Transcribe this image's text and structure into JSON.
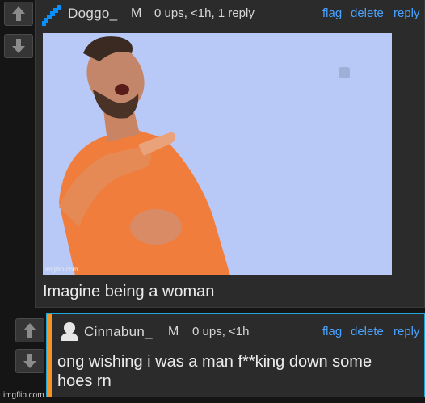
{
  "comment1": {
    "username": "Doggo_",
    "mod_badge": "M",
    "meta": "0 ups, <1h, 1 reply",
    "actions": {
      "flag": "flag",
      "delete": "delete",
      "reply": "reply"
    },
    "image_watermark": "imgflip.com",
    "text": "Imagine being a woman",
    "accent_color": "#0a8ffc"
  },
  "comment2": {
    "username": "Cinnabun_",
    "mod_badge": "M",
    "meta": "0 ups, <1h",
    "actions": {
      "flag": "flag",
      "delete": "delete",
      "reply": "reply"
    },
    "text_line1": "ong wishing i was a man f**king down some",
    "text_line2": "hoes rn",
    "highlight_color": "#f7931e",
    "border_color": "#1fa7d8"
  },
  "footer": {
    "watermark": "imgflip.com"
  }
}
